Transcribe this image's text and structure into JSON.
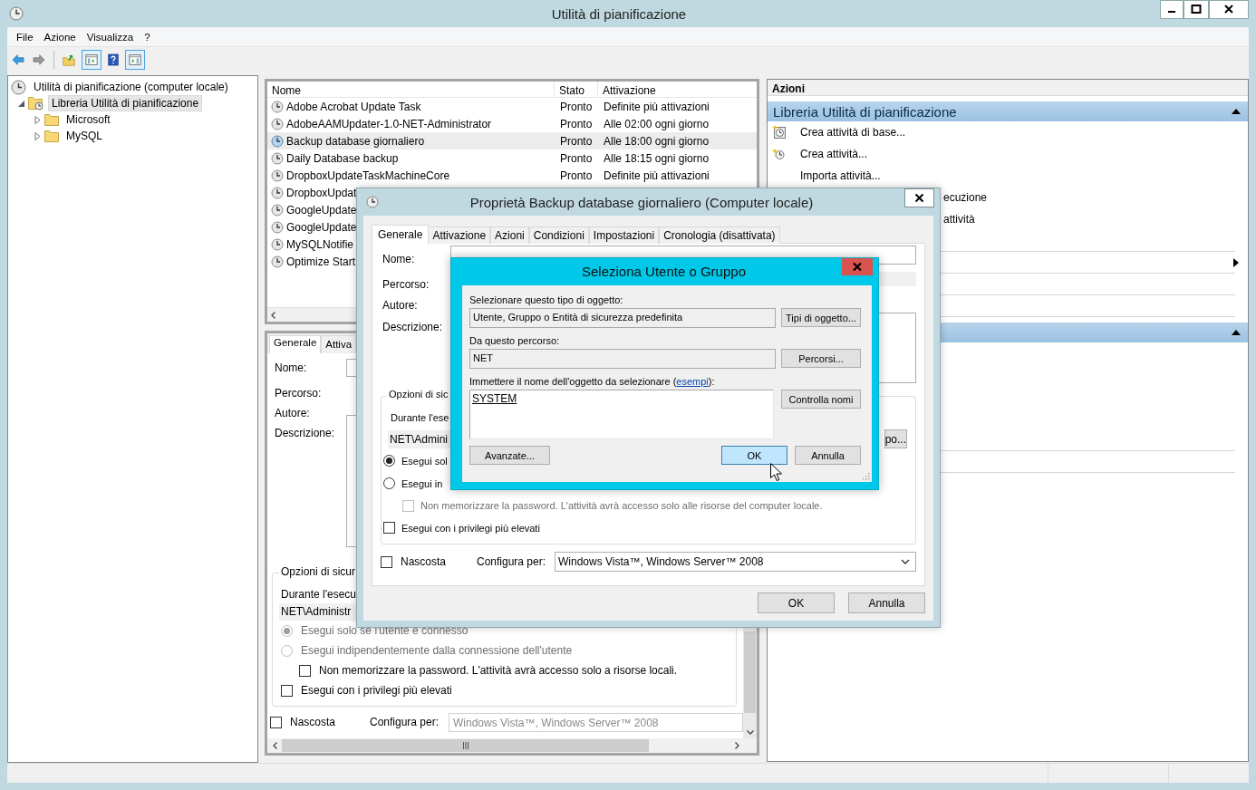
{
  "window": {
    "title": "Utilità di pianificazione"
  },
  "menu": [
    {
      "label": "File"
    },
    {
      "label": "Azione"
    },
    {
      "label": "Visualizza"
    },
    {
      "label": "?"
    }
  ],
  "toolbar": [
    {
      "kind": "back",
      "pressed": false
    },
    {
      "kind": "forward",
      "pressed": false
    },
    {
      "kind": "separator"
    },
    {
      "kind": "up",
      "pressed": false
    },
    {
      "kind": "panel-left",
      "pressed": true
    },
    {
      "kind": "help",
      "pressed": false
    },
    {
      "kind": "panel-right",
      "pressed": true
    }
  ],
  "tree": [
    {
      "kind": "root",
      "label": "Utilità di pianificazione (computer locale)",
      "selected": false,
      "children": [
        {
          "kind": "library",
          "label": "Libreria Utilità di pianificazione",
          "selected": true,
          "expanded": true,
          "children": [
            {
              "kind": "folder",
              "label": "Microsoft",
              "selected": false,
              "expanded": false
            },
            {
              "kind": "folder",
              "label": "MySQL",
              "selected": false,
              "expanded": false
            }
          ]
        }
      ]
    }
  ],
  "task_list": {
    "columns": [
      {
        "label": "Nome"
      },
      {
        "label": "Stato"
      },
      {
        "label": "Attivazione"
      }
    ],
    "rows": [
      {
        "name": "Adobe Acrobat Update Task",
        "status": "Pronto",
        "trigger": "Definite più attivazioni",
        "selected": false
      },
      {
        "name": "AdobeAAMUpdater-1.0-NET-Administrator",
        "status": "Pronto",
        "trigger": "Alle 02:00 ogni giorno",
        "selected": false
      },
      {
        "name": "Backup database giornaliero",
        "status": "Pronto",
        "trigger": "Alle 18:00 ogni giorno",
        "selected": true
      },
      {
        "name": "Daily Database backup",
        "status": "Pronto",
        "trigger": "Alle 18:15 ogni giorno",
        "selected": false
      },
      {
        "name": "DropboxUpdateTaskMachineCore",
        "status": "Pronto",
        "trigger": "Definite più attivazioni",
        "selected": false
      },
      {
        "name": "DropboxUpdat",
        "selected": false
      },
      {
        "name": "GoogleUpdate",
        "selected": false
      },
      {
        "name": "GoogleUpdate",
        "selected": false
      },
      {
        "name": "MySQLNotifie",
        "selected": false
      },
      {
        "name": "Optimize Start",
        "selected": false
      }
    ]
  },
  "detail": {
    "tabs": [
      {
        "label": "Generale",
        "selected": true
      },
      {
        "label": "Attiva",
        "selected": false
      }
    ],
    "fields": [
      {
        "label": "Nome:"
      },
      {
        "label": "Percorso:"
      },
      {
        "label": "Autore:"
      },
      {
        "label": "Descrizione:"
      }
    ],
    "security": {
      "title": "Opzioni di sicur",
      "run_as_label": "Durante l'esecu",
      "user": "NET\\Administr",
      "options": [
        {
          "kind": "radio",
          "label": "Esegui solo se l'utente è connesso",
          "checked": true,
          "disabled": true
        },
        {
          "kind": "radio",
          "label": "Esegui indipendentemente dalla connessione dell'utente",
          "checked": false,
          "disabled": true
        },
        {
          "kind": "subcheckbox",
          "label": "Non memorizzare la password. L'attività avrà accesso solo a risorse locali.",
          "checked": false,
          "disabled": false
        },
        {
          "kind": "checkbox",
          "label": "Esegui con i privilegi più elevati",
          "checked": false,
          "disabled": false
        }
      ]
    },
    "hidden": {
      "label": "Nascosta",
      "checked": false
    },
    "configure": {
      "label": "Configura per:",
      "value": "Windows Vista™, Windows Server™ 2008",
      "disabled": true
    }
  },
  "actions": {
    "title": "Azioni",
    "sections": [
      {
        "title": "Libreria Utilità di pianificazione",
        "expanded": true,
        "items": [
          {
            "kind": "create-basic",
            "label": "Crea attività di base..."
          },
          {
            "kind": "create",
            "label": "Crea attività..."
          },
          {
            "kind": "plain",
            "label": "Importa attività..."
          },
          {
            "kind": "tail",
            "label": "ecuzione"
          },
          {
            "kind": "tail",
            "label": "attività"
          }
        ],
        "blank_rows": [
          {
            "divider": true,
            "submenu": false
          },
          {
            "divider": true,
            "submenu": true
          },
          {
            "divider": true,
            "submenu": false
          },
          {
            "divider": true,
            "submenu": false
          }
        ]
      },
      {
        "expanded": true,
        "blank_rows": [
          {
            "divider": false,
            "submenu": false
          },
          {
            "divider": false,
            "submenu": false
          },
          {
            "divider": false,
            "submenu": false
          },
          {
            "divider": false,
            "submenu": false
          },
          {
            "divider": true,
            "submenu": false
          },
          {
            "divider": true,
            "submenu": false
          }
        ]
      }
    ]
  },
  "properties_dialog": {
    "title": "Proprietà Backup database giornaliero (Computer locale)",
    "tabs": [
      {
        "label": "Generale",
        "selected": true
      },
      {
        "label": "Attivazione",
        "selected": false
      },
      {
        "label": "Azioni",
        "selected": false
      },
      {
        "label": "Condizioni",
        "selected": false
      },
      {
        "label": "Impostazioni",
        "selected": false
      },
      {
        "label": "Cronologia (disattivata)",
        "selected": false
      }
    ],
    "fields": [
      {
        "label": "Nome:"
      },
      {
        "label": "Percorso:"
      },
      {
        "label": "Autore:"
      },
      {
        "label": "Descrizione:"
      }
    ],
    "security": {
      "title": "Opzioni di sic",
      "run_as_label": "Durante l'ese",
      "user": "NET\\Admini",
      "change_button": "po...",
      "options": [
        {
          "kind": "radio",
          "label": "Esegui sol",
          "checked": true,
          "disabled": false
        },
        {
          "kind": "radio",
          "label": "Esegui in",
          "checked": false,
          "disabled": false
        },
        {
          "kind": "subcheckbox",
          "label": "Non memorizzare la password. L'attività avrà accesso solo alle risorse del computer locale.",
          "checked": false,
          "disabled": true
        },
        {
          "kind": "checkbox",
          "label": "Esegui con i privilegi più elevati",
          "checked": false,
          "disabled": false
        }
      ]
    },
    "hidden": {
      "label": "Nascosta",
      "checked": false
    },
    "configure": {
      "label": "Configura per:",
      "value": "Windows Vista™, Windows Server™ 2008",
      "disabled": false
    },
    "buttons": [
      {
        "label": "OK"
      },
      {
        "label": "Annulla"
      }
    ]
  },
  "select_dialog": {
    "title": "Seleziona Utente o Gruppo",
    "object_type": {
      "label": "Selezionare questo tipo di oggetto:",
      "value": "Utente, Gruppo o Entità di sicurezza predefinita",
      "button": "Tipi di oggetto..."
    },
    "location": {
      "label": "Da questo percorso:",
      "value": "NET",
      "button": "Percorsi..."
    },
    "names": {
      "label_before": "Immettere il nome dell'oggetto da selezionare (",
      "link": "esempi",
      "label_after": "):",
      "value": "SYSTEM",
      "resolved": true,
      "button": "Controlla nomi"
    },
    "buttons": [
      {
        "kind": "advanced",
        "label": "Avanzate...",
        "default": false
      },
      {
        "kind": "confirm",
        "label": "OK",
        "default": true
      },
      {
        "kind": "cancel",
        "label": "Annulla",
        "default": false
      }
    ]
  }
}
